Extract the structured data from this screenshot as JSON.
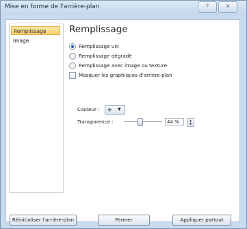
{
  "window": {
    "title": "Mise en forme de l'arrière-plan"
  },
  "sidebar": {
    "items": [
      {
        "label": "Remplissage"
      },
      {
        "label": "Image"
      }
    ]
  },
  "panel": {
    "heading": "Remplissage",
    "fill_options": [
      {
        "label": "Remplissage uni",
        "selected": true
      },
      {
        "label": "Remplissage dégradé",
        "selected": false
      },
      {
        "label": "Remplissage avec image ou texture",
        "selected": false
      }
    ],
    "hide_background_graphics": {
      "label": "Masquer les graphiques d'arrière-plan",
      "checked": false
    },
    "color": {
      "label": "Couleur :"
    },
    "transparency": {
      "label": "Transparence :",
      "value": "44 %",
      "level": 0.44
    }
  },
  "buttons": {
    "reset": "Réinitialiser l'arrière-plan",
    "close": "Fermer",
    "apply_all": "Appliquer partout"
  },
  "icons": {
    "help": "help-icon",
    "close": "close-icon",
    "paint_bucket": "paint-bucket-icon"
  }
}
